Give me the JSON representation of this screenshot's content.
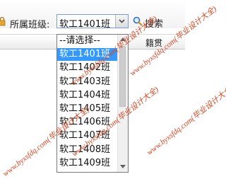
{
  "filter": {
    "label": "所属班级:",
    "selected_value": "软工1401班"
  },
  "search": {
    "label": "搜索"
  },
  "grid": {
    "columns": [
      "籍贯"
    ]
  },
  "dropdown": {
    "options": [
      "--请选择--",
      "软工1401班",
      "软工1402班",
      "软工1403班",
      "软工1404班",
      "软工1405班",
      "软工1406班",
      "软工1407班",
      "软工1408班",
      "软工1409班"
    ],
    "selected_index": 1
  },
  "watermark": {
    "text": "www.byxsfdq.com(毕业设计大全)"
  },
  "colors": {
    "selection": "#3399ff",
    "select_border": "#7a9cd3",
    "watermark": "#d9461f",
    "search_icon": "#2a6fc9"
  },
  "icons": {
    "search": "magnifier-icon",
    "dropdown_arrow": "chevron-down-icon"
  }
}
